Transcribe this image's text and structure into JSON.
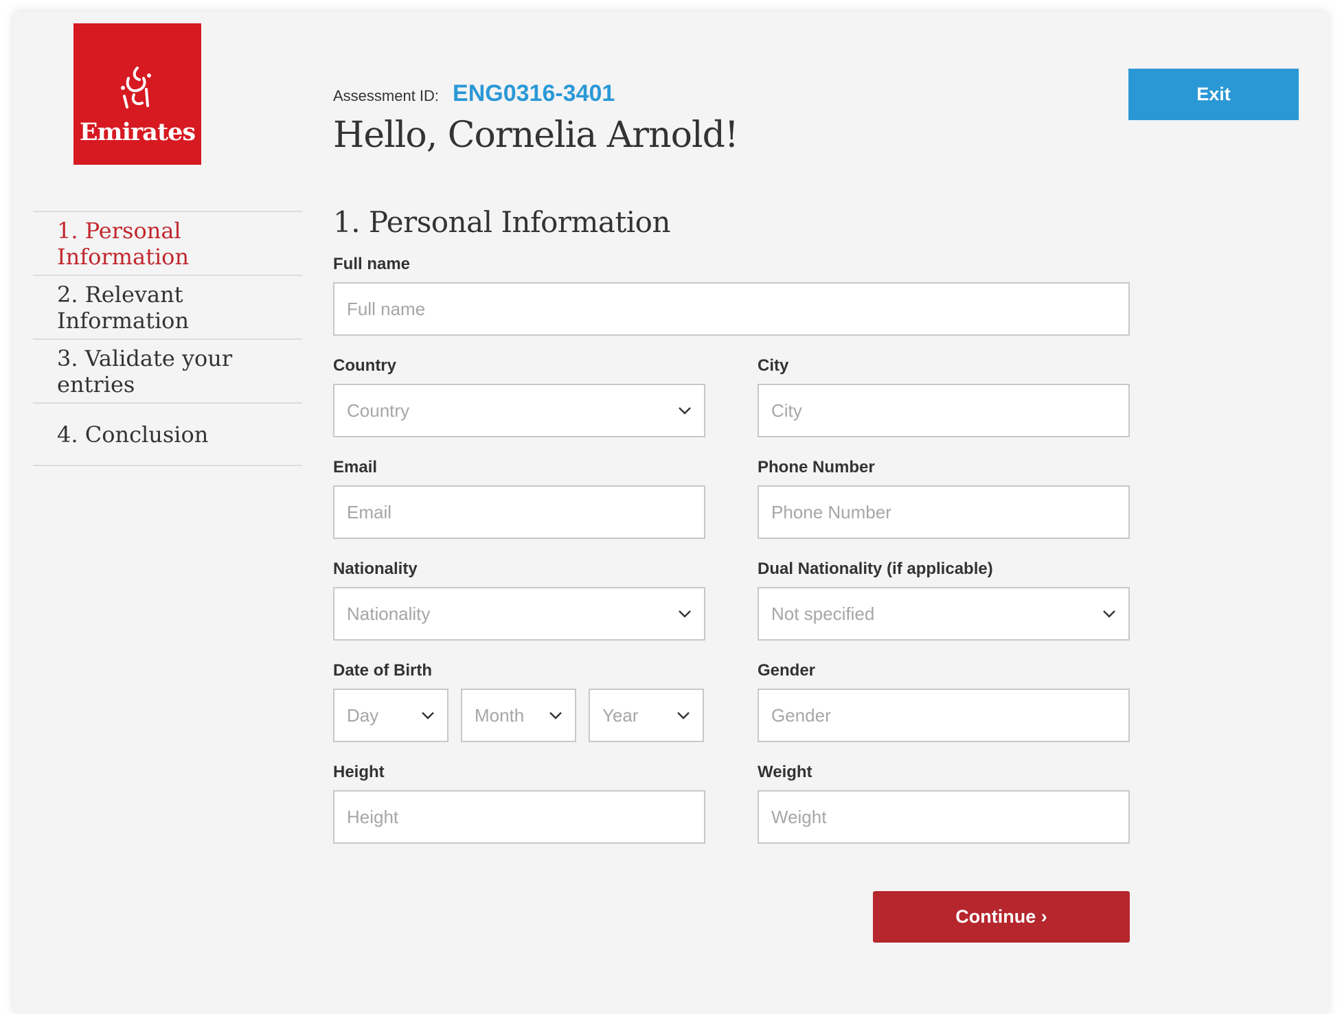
{
  "brand": {
    "logo_text": "Emirates",
    "color": "#d71921"
  },
  "header": {
    "assessment_label": "Assessment ID:",
    "assessment_id": "ENG0316-3401",
    "greeting": "Hello, Cornelia Arnold!",
    "exit_label": "Exit"
  },
  "sidebar": {
    "items": [
      {
        "label": "1. Personal Information",
        "active": true
      },
      {
        "label": "2. Relevant Information",
        "active": false
      },
      {
        "label": "3. Validate your entries",
        "active": false
      },
      {
        "label": "4. Conclusion",
        "active": false
      }
    ]
  },
  "form": {
    "section_title": "1. Personal Information",
    "full_name": {
      "label": "Full name",
      "placeholder": "Full name",
      "value": ""
    },
    "country": {
      "label": "Country",
      "selected": "Country"
    },
    "city": {
      "label": "City",
      "placeholder": "City",
      "value": ""
    },
    "email": {
      "label": "Email",
      "placeholder": "Email",
      "value": ""
    },
    "phone": {
      "label": "Phone Number",
      "placeholder": "Phone Number",
      "value": ""
    },
    "nationality": {
      "label": "Nationality",
      "selected": "Nationality"
    },
    "dual_nationality": {
      "label": "Dual Nationality (if applicable)",
      "selected": "Not specified"
    },
    "dob": {
      "label": "Date of Birth",
      "day": "Day",
      "month": "Month",
      "year": "Year"
    },
    "gender": {
      "label": "Gender",
      "placeholder": "Gender",
      "value": ""
    },
    "height": {
      "label": "Height",
      "placeholder": "Height",
      "value": ""
    },
    "weight": {
      "label": "Weight",
      "placeholder": "Weight",
      "value": ""
    },
    "continue_label": "Continue ›"
  },
  "colors": {
    "accent_blue": "#2b98d6",
    "accent_red": "#b5262d",
    "active_nav": "#c1272d"
  }
}
